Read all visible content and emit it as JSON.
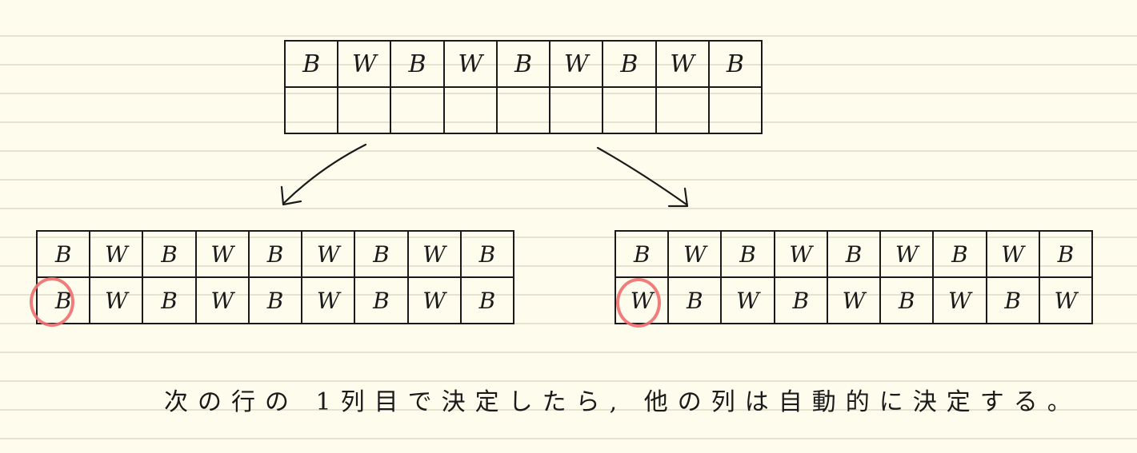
{
  "top_grid": {
    "rows": [
      [
        "B",
        "W",
        "B",
        "W",
        "B",
        "W",
        "B",
        "W",
        "B"
      ],
      [
        "",
        "",
        "",
        "",
        "",
        "",
        "",
        "",
        ""
      ]
    ]
  },
  "left_grid": {
    "rows": [
      [
        "B",
        "W",
        "B",
        "W",
        "B",
        "W",
        "B",
        "W",
        "B"
      ],
      [
        "B",
        "W",
        "B",
        "W",
        "B",
        "W",
        "B",
        "W",
        "B"
      ]
    ]
  },
  "right_grid": {
    "rows": [
      [
        "B",
        "W",
        "B",
        "W",
        "B",
        "W",
        "B",
        "W",
        "B"
      ],
      [
        "W",
        "B",
        "W",
        "B",
        "W",
        "B",
        "W",
        "B",
        "W"
      ]
    ]
  },
  "caption": "次の行の 1列目で決定したら, 他の列は自動的に決定する。",
  "colors": {
    "highlight": "#ee6f6f",
    "ink": "#1a1a1a",
    "paper": "#fefcec"
  }
}
